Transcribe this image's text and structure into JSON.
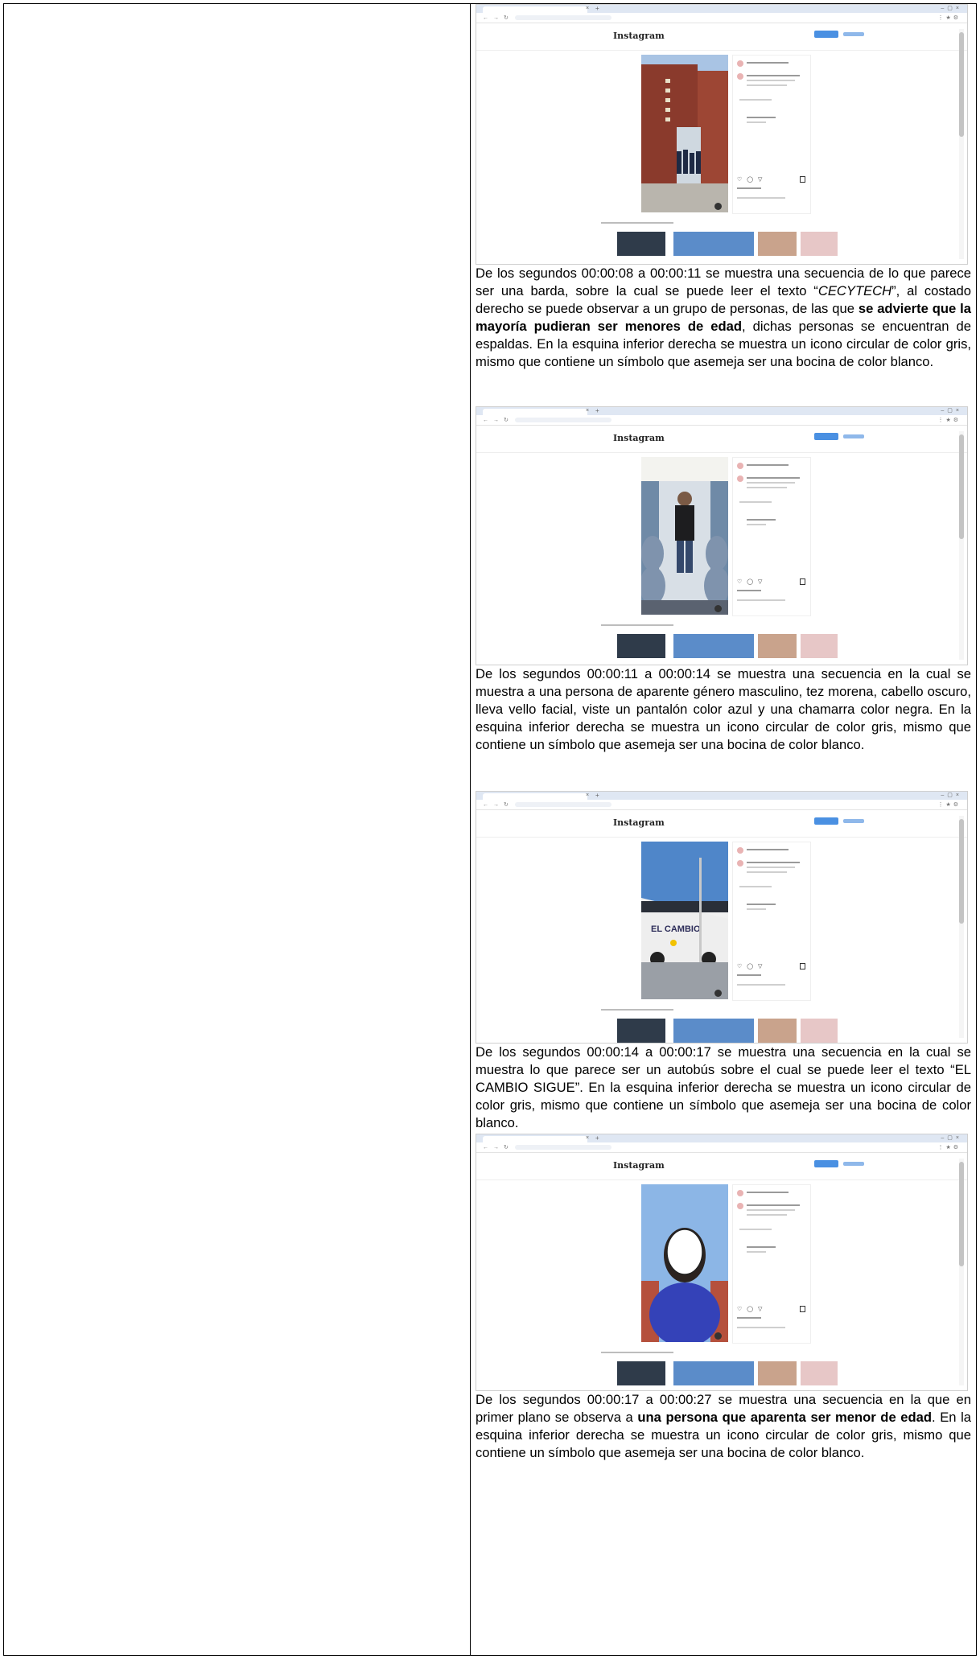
{
  "entries": [
    {
      "scene": "wall",
      "description": {
        "p1": "De los segundos 00:00:08 a 00:00:11 se muestra una secuencia de lo que parece ser una barda, sobre la cual se puede leer el texto “",
        "italic": "CECYTECH",
        "p2": "”, al costado derecho se puede observar a un grupo de personas, de las que ",
        "bold": "se advierte que la mayoría pudieran ser menores de edad",
        "p3": ", dichas personas se encuentran de espaldas. En la esquina inferior derecha se muestra un icono circular de color gris, mismo que contiene un símbolo que asemeja ser una bocina de color blanco."
      }
    },
    {
      "scene": "bus-interior",
      "description": {
        "p1": "De los segundos 00:00:11 a 00:00:14 se muestra una secuencia en la cual se muestra a una persona de aparente género masculino, tez morena, cabello oscuro, lleva vello facial, viste un pantalón color azul y una chamarra color negra. En la esquina inferior derecha se muestra un icono circular de color gris, mismo que contiene un símbolo que asemeja ser una bocina de color blanco."
      }
    },
    {
      "scene": "bus-exterior",
      "bus_text": "EL CAMBIO",
      "description": {
        "p1": "De los segundos 00:00:14 a 00:00:17 se muestra una secuencia en la cual se muestra lo que parece ser un autobús sobre el cual se puede leer el texto “EL CAMBIO SIGUE”. En la esquina inferior derecha se muestra un icono circular de color gris, mismo que contiene un símbolo que asemeja ser una bocina de color blanco."
      }
    },
    {
      "scene": "person-closeup",
      "description": {
        "p1": "De los segundos 00:00:17 a 00:00:27 se muestra una secuencia en la que en primer plano se observa a ",
        "bold": "una persona que aparenta ser menor de edad",
        "p2": ". En la esquina inferior derecha se muestra un icono circular de color gris, mismo que contiene un símbolo que asemeja ser una bocina de color blanco."
      }
    }
  ],
  "screenshot_ui": {
    "logo_text": "Instagram",
    "icons": [
      "heart-icon",
      "comment-icon",
      "share-icon",
      "bookmark-icon",
      "speaker-icon"
    ],
    "accent": "#4a90e2"
  }
}
